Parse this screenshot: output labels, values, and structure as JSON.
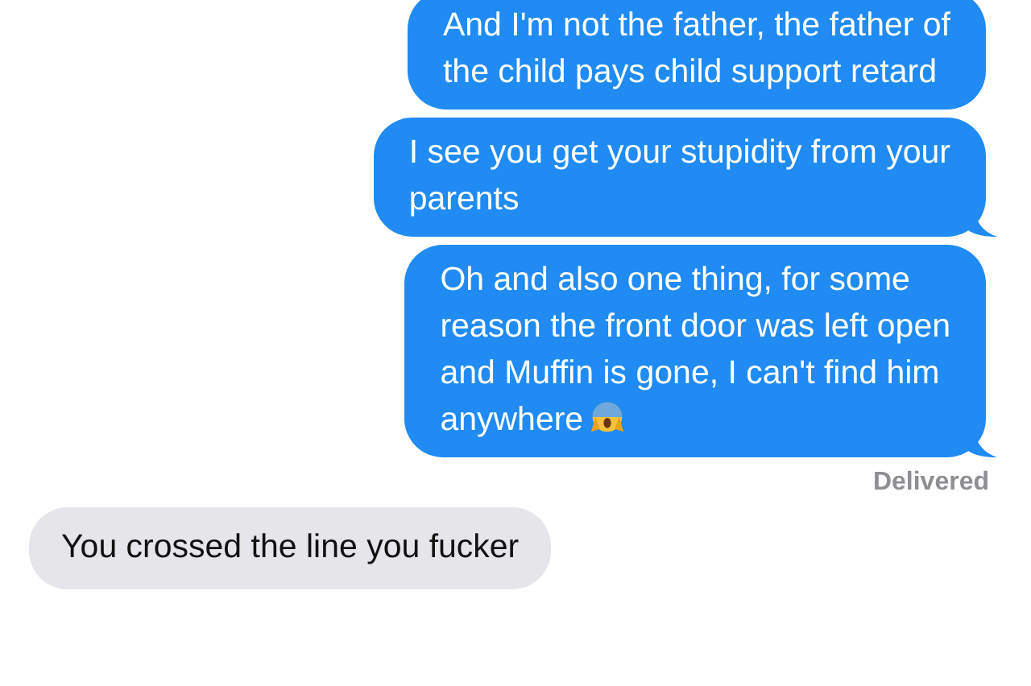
{
  "messages": [
    {
      "kind": "sent",
      "tail": false,
      "lines": [
        "And I'm not the father, the father of",
        "the child pays child support retard"
      ]
    },
    {
      "kind": "sent",
      "tail": true,
      "lines": [
        "I see you get your stupidity from your",
        "parents"
      ]
    },
    {
      "kind": "sent",
      "tail": true,
      "end_icon": true,
      "lines": [
        "Oh and also one thing, for some",
        "reason the front door was left open",
        "and Muffin is gone, I can't find him",
        "anywhere"
      ]
    },
    {
      "kind": "status",
      "text": "Delivered"
    },
    {
      "kind": "received",
      "tail": false,
      "lines": [
        "You crossed the line you fucker"
      ]
    }
  ]
}
